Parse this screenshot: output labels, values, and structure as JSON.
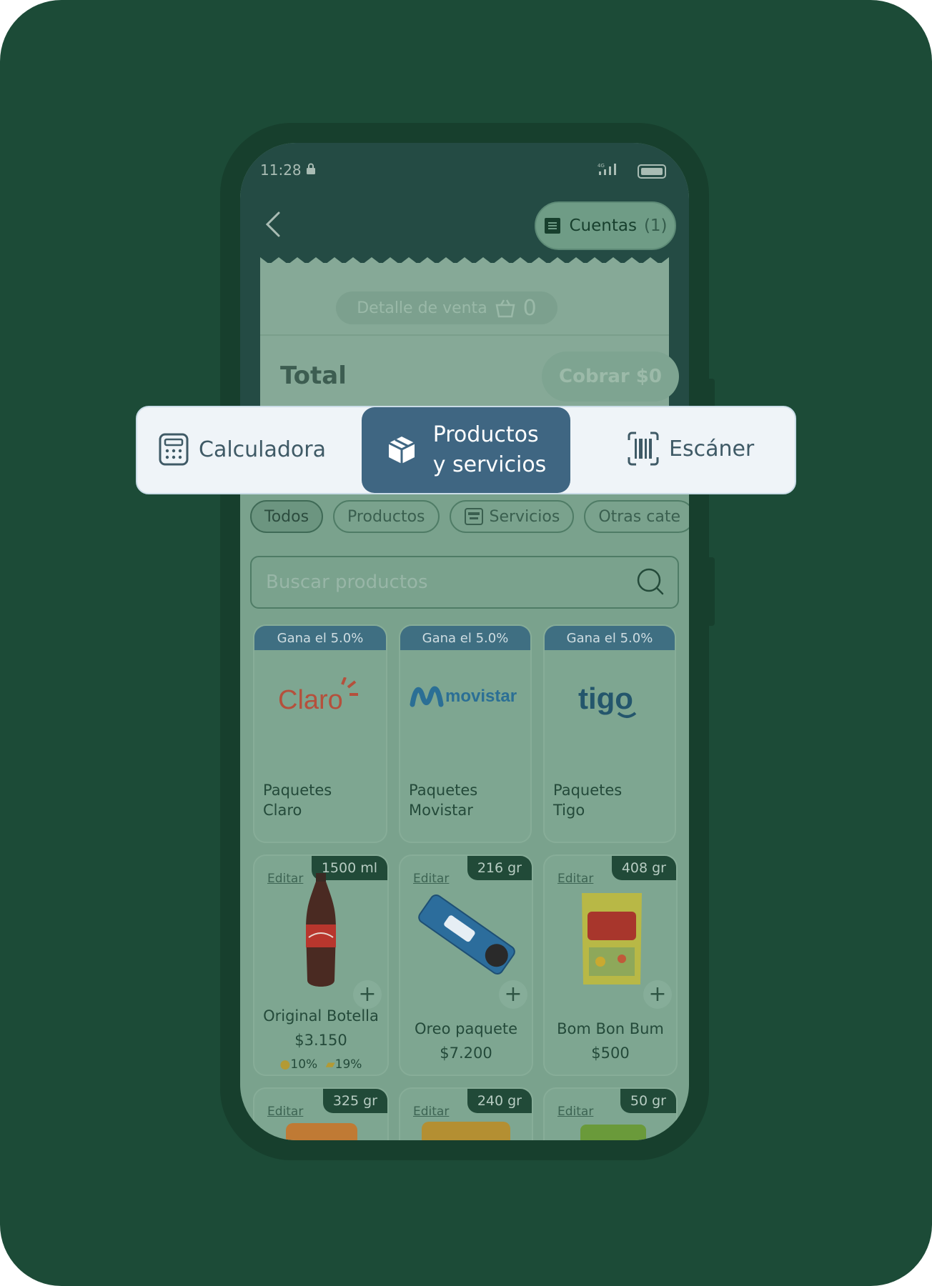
{
  "status": {
    "time": "11:28",
    "network": "4G"
  },
  "header": {
    "cuentas_label": "Cuentas",
    "cuentas_count": "(1)"
  },
  "receipt": {
    "detalle_label": "Detalle de venta",
    "basket_count": "0",
    "total_label": "Total",
    "cobrar_label": "Cobrar $0"
  },
  "segments": [
    {
      "label": "Calculadora"
    },
    {
      "label_line1": "Productos",
      "label_line2": "y servicios"
    },
    {
      "label": "Escáner"
    }
  ],
  "chips": [
    {
      "label": "Todos",
      "active": true
    },
    {
      "label": "Productos"
    },
    {
      "label": "Servicios"
    },
    {
      "label": "Otras cate"
    }
  ],
  "search": {
    "placeholder": "Buscar productos"
  },
  "packages": [
    {
      "badge": "Gana el 5.0%",
      "brand": "Claro",
      "name1": "Paquetes",
      "name2": "Claro"
    },
    {
      "badge": "Gana el 5.0%",
      "brand": "movistar",
      "name1": "Paquetes",
      "name2": "Movistar"
    },
    {
      "badge": "Gana el 5.0%",
      "brand": "tigo",
      "name1": "Paquetes",
      "name2": "Tigo"
    }
  ],
  "products": [
    {
      "edit": "Editar",
      "size": "1500 ml",
      "name": "Original Botella",
      "price": "$3.150",
      "tax1": "10%",
      "tax2": "19%"
    },
    {
      "edit": "Editar",
      "size": "216 gr",
      "name": "Oreo paquete",
      "price": "$7.200"
    },
    {
      "edit": "Editar",
      "size": "408 gr",
      "name": "Bom Bon Bum",
      "price": "$500"
    },
    {
      "edit": "Editar",
      "size": "325 gr"
    },
    {
      "edit": "Editar",
      "size": "240 gr"
    },
    {
      "edit": "Editar",
      "size": "50 gr"
    }
  ],
  "colors": {
    "backdrop": "#1c4b37",
    "segment_active": "#3f6682",
    "claro": "#b5503c",
    "movistar": "#2b6f95",
    "tigo": "#24566c"
  }
}
